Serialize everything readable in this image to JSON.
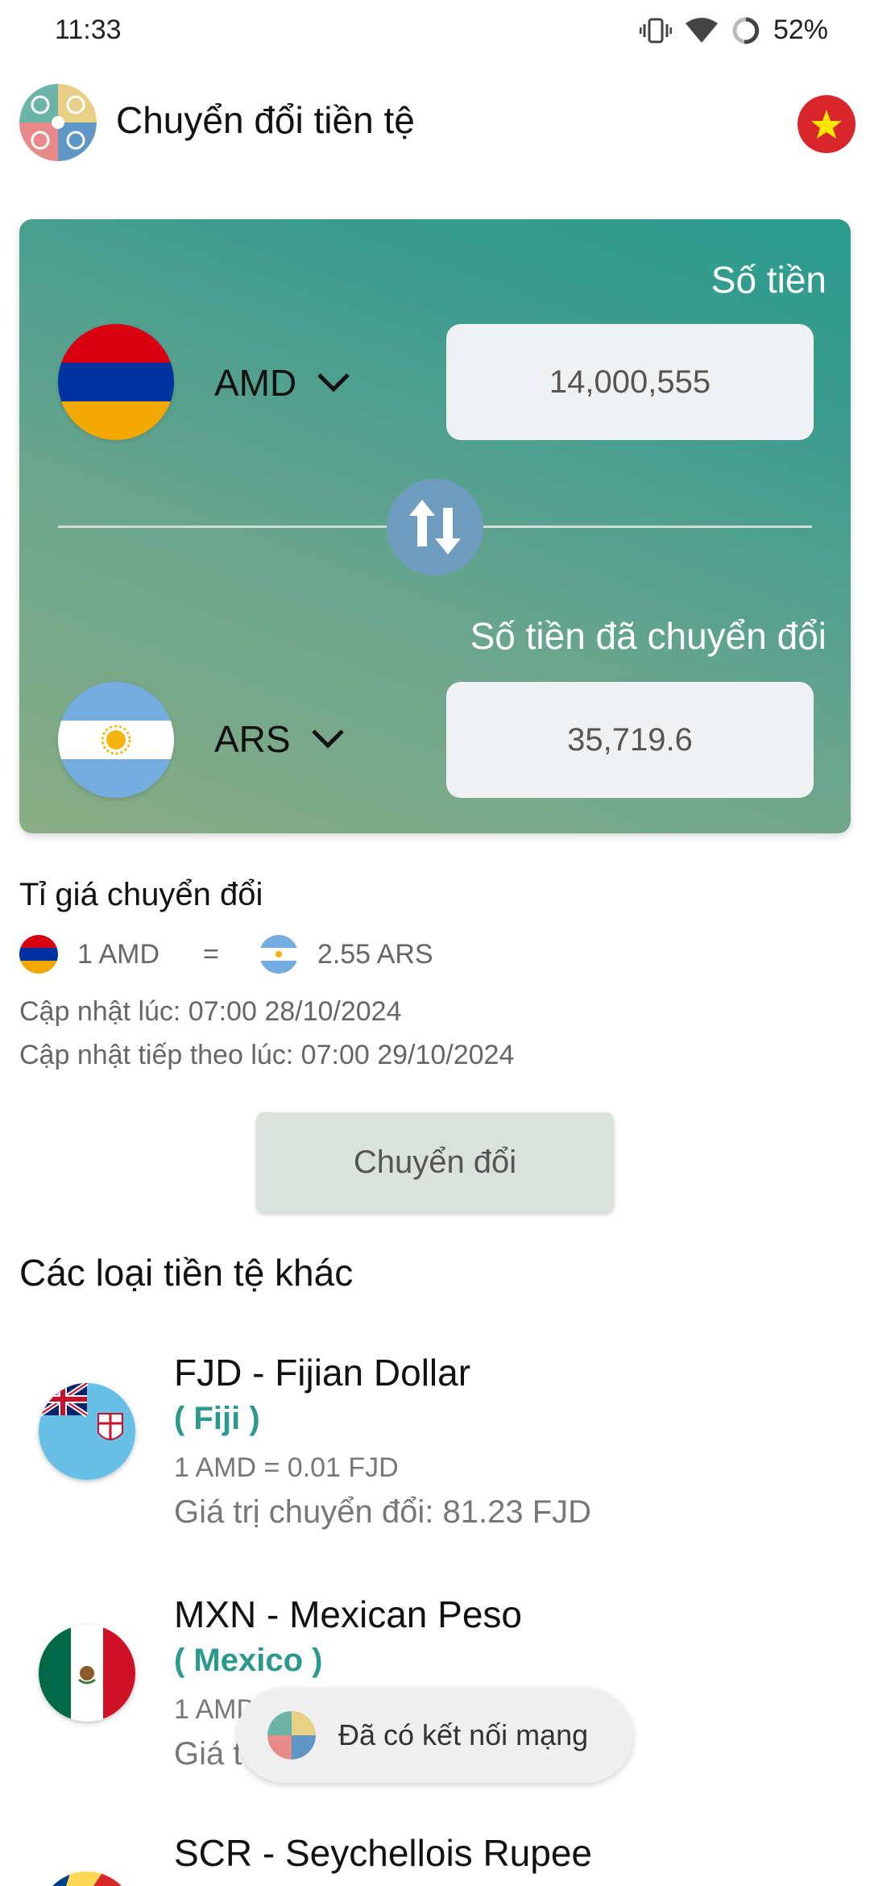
{
  "status_bar": {
    "time": "11:33",
    "battery": "52%"
  },
  "app_bar": {
    "title": "Chuyển đổi tiền tệ"
  },
  "converter": {
    "amount_label": "Số tiền",
    "from_currency": "AMD",
    "amount_value": "14,000,555",
    "converted_label": "Số tiền đã chuyển đổi",
    "to_currency": "ARS",
    "converted_value": "35,719.6"
  },
  "rate": {
    "title": "Tỉ giá chuyển đổi",
    "left": "1 AMD",
    "equals": "=",
    "right": "2.55 ARS",
    "updated": "Cập nhật lúc: 07:00 28/10/2024",
    "next_update": "Cập nhật tiếp theo lúc: 07:00 29/10/2024"
  },
  "convert_button": "Chuyển đổi",
  "other": {
    "title": "Các loại tiền tệ khác",
    "items": [
      {
        "name": "FJD - Fijian Dollar",
        "country": "( Fiji )",
        "rate": "1 AMD = 0.01 FJD",
        "value": "Giá trị chuyển đổi: 81.23 FJD"
      },
      {
        "name": "MXN - Mexican Peso",
        "country": "( Mexico )",
        "rate": "1 AMD",
        "value": "Giá t"
      },
      {
        "name": "SCR - Seychellois Rupee"
      }
    ]
  },
  "toast": "Đã có kết nối mạng",
  "colors": {
    "accent": "#2b9a8c",
    "card_start": "#8aad85",
    "card_end": "#2a9b8c",
    "swap": "#6e9cbf"
  }
}
